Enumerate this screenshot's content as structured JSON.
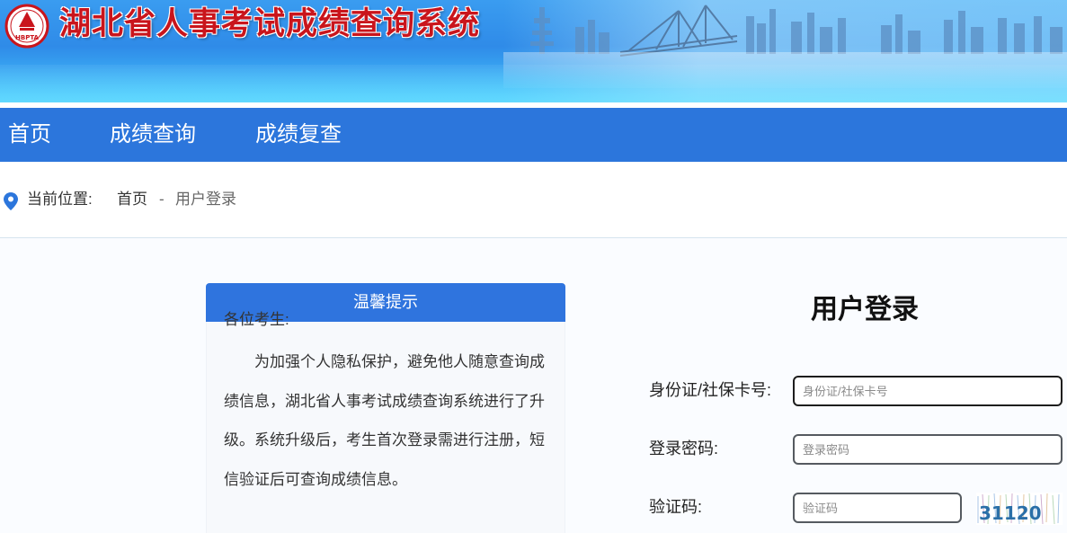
{
  "header": {
    "title": "湖北省人事考试成绩查询系统",
    "logo_text": "HBPTA"
  },
  "nav": {
    "items": [
      {
        "label": "首页"
      },
      {
        "label": "成绩查询"
      },
      {
        "label": "成绩复查"
      }
    ]
  },
  "breadcrumb": {
    "prefix": "当前位置:",
    "home": "首页",
    "separator": "-",
    "current": "用户登录"
  },
  "notice": {
    "title": "温馨提示",
    "greeting": "各位考生:",
    "body": "为加强个人隐私保护，避免他人随意查询成绩信息，湖北省人事考试成绩查询系统进行了升级。系统升级后，考生首次登录需进行注册，短信验证后可查询成绩信息。"
  },
  "login": {
    "title": "用户登录",
    "id_label": "身份证/社保卡号:",
    "id_placeholder": "身份证/社保卡号",
    "password_label": "登录密码:",
    "password_placeholder": "登录密码",
    "captcha_label": "验证码:",
    "captcha_placeholder": "验证码",
    "captcha_text": "31120"
  },
  "colors": {
    "nav_bg": "#2c76dc",
    "notice_header": "#2f74de",
    "title_red": "#c9151c"
  }
}
